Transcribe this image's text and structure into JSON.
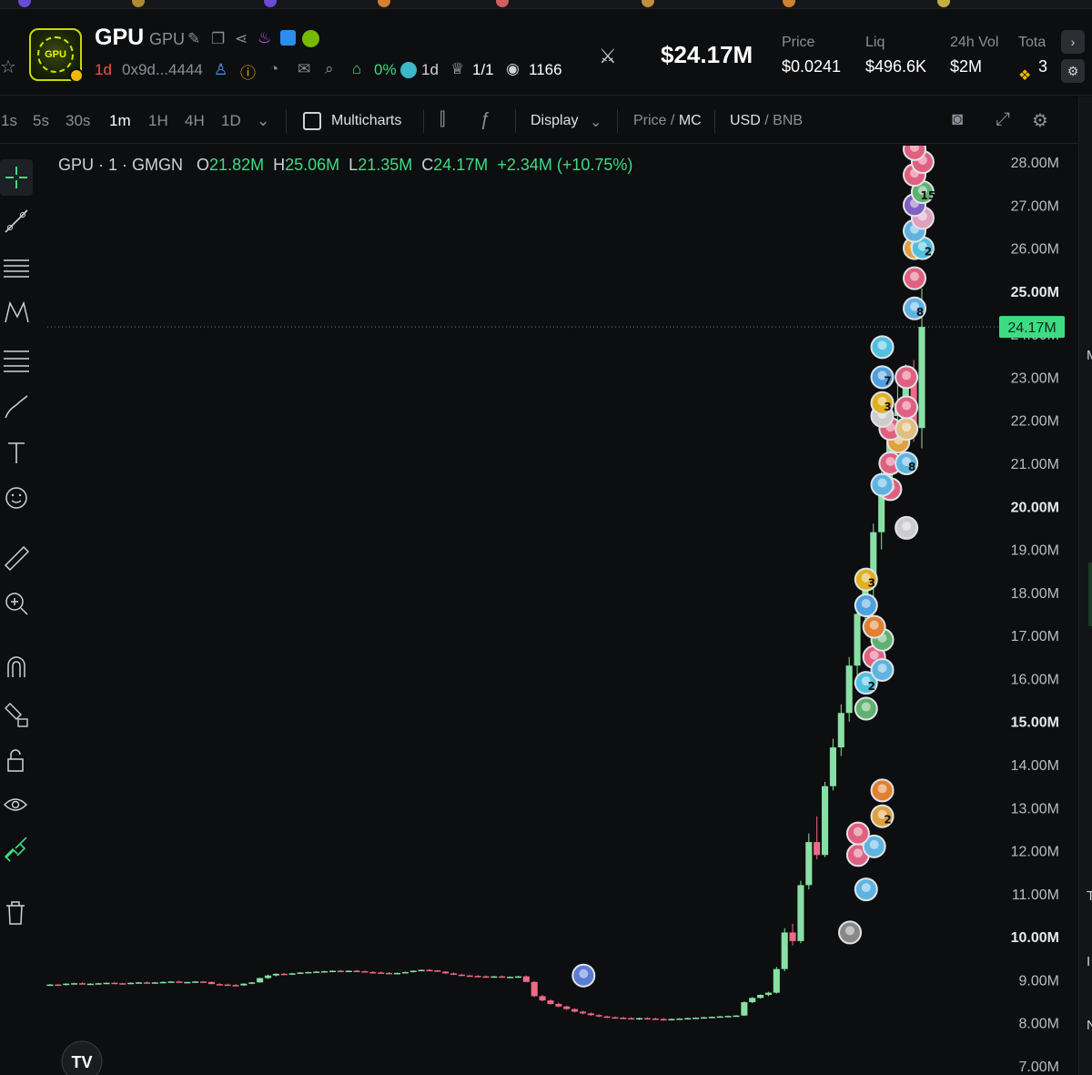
{
  "header": {
    "token_name": "GPU",
    "token_symbol": "GPU",
    "age": "1d",
    "address": "0x9d...4444",
    "tax": "0%",
    "pool_age": "1d",
    "holders_ratio": "1/1",
    "views": "1166",
    "market_cap": "$24.17M",
    "stats": [
      {
        "label": "Price",
        "value": "$0.0241"
      },
      {
        "label": "Liq",
        "value": "$496.6K"
      },
      {
        "label": "24h Vol",
        "value": "$2M"
      },
      {
        "label": "Tota",
        "value": "3"
      }
    ],
    "logo_text": "GPU"
  },
  "toolbar": {
    "timeframes": [
      "1s",
      "5s",
      "30s",
      "1m",
      "1H",
      "4H",
      "1D"
    ],
    "active_timeframe": "1m",
    "multicharts_label": "Multicharts",
    "display_label": "Display",
    "price_label": "Price",
    "mc_label": "MC",
    "usd_label": "USD",
    "bnb_label": "BNB",
    "separator": "/"
  },
  "legend": {
    "symbol": "GPU · 1 · GMGN",
    "o_label": "O",
    "o_value": "21.82M",
    "h_label": "H",
    "h_value": "25.06M",
    "l_label": "L",
    "l_value": "21.35M",
    "c_label": "C",
    "c_value": "24.17M",
    "change": "+2.34M (+10.75%)"
  },
  "chart_data": {
    "type": "candlestick",
    "y_axis_ticks": [
      "28.00M",
      "27.00M",
      "26.00M",
      "25.00M",
      "24.00M",
      "23.00M",
      "22.00M",
      "21.00M",
      "20.00M",
      "19.00M",
      "18.00M",
      "17.00M",
      "16.00M",
      "15.00M",
      "14.00M",
      "13.00M",
      "12.00M",
      "11.00M",
      "10.00M",
      "9.00M",
      "8.00M",
      "7.00M"
    ],
    "bold_ticks": [
      "25.00M",
      "20.00M",
      "15.00M",
      "10.00M"
    ],
    "ylim": [
      7,
      28.2
    ],
    "last_price_label": "24.17M",
    "last_price": 24.17,
    "colors": {
      "up": "#89e0a4",
      "down": "#f06a85",
      "last": "#3ddc84",
      "grid_line": "#3ddc84"
    },
    "candles": [
      [
        8.88,
        8.9,
        8.86,
        8.89
      ],
      [
        8.89,
        8.9,
        8.87,
        8.88
      ],
      [
        8.88,
        8.92,
        8.87,
        8.91
      ],
      [
        8.91,
        8.93,
        8.9,
        8.92
      ],
      [
        8.92,
        8.94,
        8.91,
        8.9
      ],
      [
        8.9,
        8.92,
        8.88,
        8.91
      ],
      [
        8.91,
        8.93,
        8.89,
        8.92
      ],
      [
        8.92,
        8.94,
        8.91,
        8.93
      ],
      [
        8.93,
        8.95,
        8.92,
        8.92
      ],
      [
        8.92,
        8.93,
        8.9,
        8.91
      ],
      [
        8.91,
        8.94,
        8.9,
        8.93
      ],
      [
        8.93,
        8.95,
        8.92,
        8.94
      ],
      [
        8.94,
        8.96,
        8.93,
        8.93
      ],
      [
        8.93,
        8.95,
        8.92,
        8.94
      ],
      [
        8.94,
        8.96,
        8.93,
        8.95
      ],
      [
        8.95,
        8.97,
        8.94,
        8.96
      ],
      [
        8.96,
        8.98,
        8.95,
        8.94
      ],
      [
        8.94,
        8.95,
        8.93,
        8.95
      ],
      [
        8.95,
        8.97,
        8.93,
        8.96
      ],
      [
        8.96,
        8.97,
        8.94,
        8.95
      ],
      [
        8.95,
        8.96,
        8.92,
        8.9
      ],
      [
        8.9,
        8.92,
        8.88,
        8.89
      ],
      [
        8.89,
        8.91,
        8.86,
        8.88
      ],
      [
        8.88,
        8.9,
        8.86,
        8.87
      ],
      [
        8.87,
        8.92,
        8.86,
        8.91
      ],
      [
        8.91,
        8.95,
        8.9,
        8.94
      ],
      [
        8.94,
        9.05,
        8.93,
        9.04
      ],
      [
        9.04,
        9.12,
        9.02,
        9.1
      ],
      [
        9.1,
        9.15,
        9.08,
        9.14
      ],
      [
        9.14,
        9.16,
        9.12,
        9.13
      ],
      [
        9.13,
        9.16,
        9.12,
        9.15
      ],
      [
        9.15,
        9.18,
        9.14,
        9.17
      ],
      [
        9.17,
        9.19,
        9.15,
        9.18
      ],
      [
        9.18,
        9.2,
        9.16,
        9.19
      ],
      [
        9.19,
        9.21,
        9.17,
        9.2
      ],
      [
        9.2,
        9.22,
        9.18,
        9.21
      ],
      [
        9.21,
        9.23,
        9.19,
        9.2
      ],
      [
        9.2,
        9.22,
        9.18,
        9.21
      ],
      [
        9.21,
        9.23,
        9.19,
        9.2
      ],
      [
        9.2,
        9.21,
        9.17,
        9.18
      ],
      [
        9.18,
        9.2,
        9.15,
        9.17
      ],
      [
        9.17,
        9.19,
        9.15,
        9.16
      ],
      [
        9.16,
        9.18,
        9.14,
        9.15
      ],
      [
        9.15,
        9.17,
        9.13,
        9.16
      ],
      [
        9.16,
        9.19,
        9.15,
        9.18
      ],
      [
        9.18,
        9.22,
        9.17,
        9.21
      ],
      [
        9.21,
        9.24,
        9.2,
        9.23
      ],
      [
        9.23,
        9.25,
        9.21,
        9.22
      ],
      [
        9.22,
        9.23,
        9.18,
        9.19
      ],
      [
        9.19,
        9.2,
        9.14,
        9.15
      ],
      [
        9.15,
        9.17,
        9.11,
        9.12
      ],
      [
        9.12,
        9.14,
        9.09,
        9.1
      ],
      [
        9.1,
        9.12,
        9.08,
        9.09
      ],
      [
        9.09,
        9.11,
        9.07,
        9.08
      ],
      [
        9.08,
        9.1,
        9.06,
        9.07
      ],
      [
        9.07,
        9.09,
        9.05,
        9.08
      ],
      [
        9.08,
        9.1,
        9.05,
        9.06
      ],
      [
        9.06,
        9.08,
        9.04,
        9.07
      ],
      [
        9.07,
        9.09,
        9.05,
        9.08
      ],
      [
        9.08,
        9.1,
        9.05,
        8.95
      ],
      [
        8.95,
        8.97,
        8.6,
        8.62
      ],
      [
        8.62,
        8.65,
        8.5,
        8.52
      ],
      [
        8.52,
        8.55,
        8.42,
        8.44
      ],
      [
        8.44,
        8.47,
        8.36,
        8.38
      ],
      [
        8.38,
        8.4,
        8.3,
        8.32
      ],
      [
        8.32,
        8.34,
        8.24,
        8.26
      ],
      [
        8.26,
        8.28,
        8.2,
        8.22
      ],
      [
        8.22,
        8.24,
        8.16,
        8.18
      ],
      [
        8.18,
        8.2,
        8.13,
        8.15
      ],
      [
        8.15,
        8.17,
        8.11,
        8.13
      ],
      [
        8.13,
        8.15,
        8.1,
        8.12
      ],
      [
        8.12,
        8.14,
        8.09,
        8.11
      ],
      [
        8.11,
        8.13,
        8.08,
        8.1
      ],
      [
        8.1,
        8.12,
        8.07,
        8.11
      ],
      [
        8.11,
        8.13,
        8.08,
        8.1
      ],
      [
        8.1,
        8.12,
        8.07,
        8.09
      ],
      [
        8.09,
        8.11,
        8.05,
        8.08
      ],
      [
        8.08,
        8.1,
        8.06,
        8.09
      ],
      [
        8.09,
        8.11,
        8.07,
        8.1
      ],
      [
        8.1,
        8.12,
        8.08,
        8.11
      ],
      [
        8.11,
        8.13,
        8.09,
        8.12
      ],
      [
        8.12,
        8.14,
        8.1,
        8.13
      ],
      [
        8.13,
        8.15,
        8.11,
        8.14
      ],
      [
        8.14,
        8.16,
        8.12,
        8.15
      ],
      [
        8.15,
        8.17,
        8.13,
        8.16
      ],
      [
        8.16,
        8.18,
        8.14,
        8.17
      ],
      [
        8.17,
        8.5,
        8.16,
        8.48
      ],
      [
        8.48,
        8.6,
        8.46,
        8.58
      ],
      [
        8.58,
        8.66,
        8.56,
        8.65
      ],
      [
        8.65,
        8.72,
        8.62,
        8.7
      ],
      [
        8.7,
        9.3,
        8.68,
        9.25
      ],
      [
        9.25,
        10.2,
        9.2,
        10.1
      ],
      [
        10.1,
        10.3,
        9.8,
        9.9
      ],
      [
        9.9,
        11.3,
        9.85,
        11.2
      ],
      [
        11.2,
        12.4,
        11.1,
        12.2
      ],
      [
        12.2,
        12.8,
        11.8,
        11.9
      ],
      [
        11.9,
        13.6,
        11.85,
        13.5
      ],
      [
        13.5,
        14.6,
        13.4,
        14.4
      ],
      [
        14.4,
        15.4,
        14.2,
        15.2
      ],
      [
        15.2,
        16.5,
        15.0,
        16.3
      ],
      [
        16.3,
        17.8,
        16.0,
        17.5
      ],
      [
        17.5,
        18.4,
        17.2,
        18.2
      ],
      [
        18.2,
        19.6,
        17.8,
        19.4
      ],
      [
        19.4,
        20.8,
        19.0,
        20.6
      ],
      [
        20.6,
        22.5,
        20.2,
        22.1
      ],
      [
        22.1,
        22.9,
        21.6,
        22.4
      ],
      [
        22.4,
        23.3,
        22.0,
        23.1
      ],
      [
        23.1,
        23.4,
        21.5,
        21.8
      ],
      [
        21.82,
        25.06,
        21.35,
        24.17
      ]
    ],
    "markers": [
      {
        "index": 67,
        "value": 9.1,
        "color": "#5b7bd5",
        "label": ""
      },
      {
        "index": 100,
        "value": 10.1,
        "color": "#888888",
        "label": ""
      },
      {
        "index": 102,
        "value": 11.1,
        "color": "#5fb3e0",
        "label": ""
      },
      {
        "index": 101,
        "value": 11.9,
        "color": "#e06080",
        "label": ""
      },
      {
        "index": 103,
        "value": 12.1,
        "color": "#5fb3e0",
        "label": ""
      },
      {
        "index": 101,
        "value": 12.4,
        "color": "#e06080",
        "label": ""
      },
      {
        "index": 104,
        "value": 12.8,
        "color": "#e0a040",
        "label": "2"
      },
      {
        "index": 104,
        "value": 13.4,
        "color": "#e08030",
        "label": ""
      },
      {
        "index": 102,
        "value": 15.3,
        "color": "#60b070",
        "label": ""
      },
      {
        "index": 102,
        "value": 15.9,
        "color": "#4fc0e0",
        "label": "2"
      },
      {
        "index": 103,
        "value": 16.5,
        "color": "#e06080",
        "label": ""
      },
      {
        "index": 104,
        "value": 16.2,
        "color": "#5fb3e0",
        "label": ""
      },
      {
        "index": 104,
        "value": 16.9,
        "color": "#60b070",
        "label": ""
      },
      {
        "index": 103,
        "value": 17.2,
        "color": "#e08030",
        "label": ""
      },
      {
        "index": 102,
        "value": 17.7,
        "color": "#4fa0e0",
        "label": ""
      },
      {
        "index": 102,
        "value": 18.3,
        "color": "#e0b020",
        "label": "3"
      },
      {
        "index": 107,
        "value": 19.5,
        "color": "#cccccc",
        "label": ""
      },
      {
        "index": 105,
        "value": 20.4,
        "color": "#e06080",
        "label": ""
      },
      {
        "index": 104,
        "value": 20.5,
        "color": "#5fb3e0",
        "label": ""
      },
      {
        "index": 105,
        "value": 21.0,
        "color": "#e06080",
        "label": ""
      },
      {
        "index": 107,
        "value": 21.0,
        "color": "#5fb3e0",
        "label": "8"
      },
      {
        "index": 106,
        "value": 21.5,
        "color": "#e0a040",
        "label": ""
      },
      {
        "index": 105,
        "value": 21.8,
        "color": "#e06080",
        "label": ""
      },
      {
        "index": 104,
        "value": 22.1,
        "color": "#cccccc",
        "label": ""
      },
      {
        "index": 107,
        "value": 21.8,
        "color": "#e0c080",
        "label": ""
      },
      {
        "index": 104,
        "value": 22.4,
        "color": "#e0b020",
        "label": "3"
      },
      {
        "index": 107,
        "value": 22.3,
        "color": "#e06080",
        "label": ""
      },
      {
        "index": 104,
        "value": 23.0,
        "color": "#4fa0e0",
        "label": "7"
      },
      {
        "index": 107,
        "value": 23.0,
        "color": "#e06080",
        "label": ""
      },
      {
        "index": 104,
        "value": 23.7,
        "color": "#4fc0e0",
        "label": ""
      },
      {
        "index": 108,
        "value": 24.6,
        "color": "#5fb3e0",
        "label": "8"
      },
      {
        "index": 108,
        "value": 25.3,
        "color": "#e06080",
        "label": ""
      },
      {
        "index": 108,
        "value": 26.0,
        "color": "#e0a040",
        "label": "2"
      },
      {
        "index": 109,
        "value": 26.0,
        "color": "#4fc0e0",
        "label": "2"
      },
      {
        "index": 108,
        "value": 26.4,
        "color": "#5fb3e0",
        "label": ""
      },
      {
        "index": 109,
        "value": 26.7,
        "color": "#e0a0c0",
        "label": ""
      },
      {
        "index": 108,
        "value": 27.0,
        "color": "#8060c0",
        "label": ""
      },
      {
        "index": 109,
        "value": 27.3,
        "color": "#60b070",
        "label": "15"
      },
      {
        "index": 108,
        "value": 27.7,
        "color": "#e06080",
        "label": ""
      },
      {
        "index": 109,
        "value": 28.0,
        "color": "#e06080",
        "label": ""
      },
      {
        "index": 108,
        "value": 28.3,
        "color": "#e06080",
        "label": ""
      }
    ]
  },
  "right_edge": {
    "labels": [
      "M",
      "T",
      "I",
      "N"
    ]
  }
}
